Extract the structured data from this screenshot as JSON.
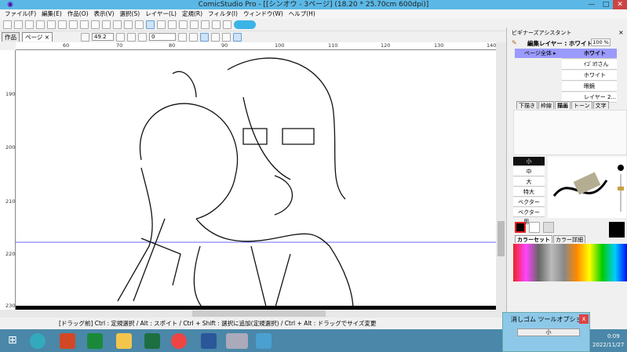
{
  "window": {
    "title": "ComicStudio Pro - [[シンオウ - 3ページ] (18.20 * 25.70cm 600dpi)]",
    "min": "—",
    "max": "□",
    "close": "✕"
  },
  "menu": [
    "ファイル(F)",
    "編集(E)",
    "作品(O)",
    "表示(V)",
    "選択(S)",
    "レイヤー(L)",
    "定規(R)",
    "フィルタ(I)",
    "ウィンドウ(W)",
    "ヘルプ(H)"
  ],
  "toolbar2": {
    "tabs": [
      "作品",
      "ページ ×"
    ],
    "zoom": "49.2",
    "angle": "0"
  },
  "rulers": {
    "h": [
      "60",
      "70",
      "80",
      "90",
      "100",
      "110",
      "120",
      "130",
      "140"
    ],
    "v": [
      "190",
      "200",
      "210",
      "220",
      "230"
    ]
  },
  "status": "[ドラッグ前] Ctrl : 定規選択 / Alt : スポイト / Ctrl + Shift : 選択に追加(定規選択) / Ctrl + Alt : ドラッグでサイズ変更",
  "panel": {
    "title": "ビギナーズアシスタント",
    "close": "×",
    "edit_layer_label": "編集レイヤー : ホワイト",
    "opacity": "100 %",
    "page_all": "ページ全体 ▸",
    "layers": [
      {
        "name": "ホワイト",
        "selected": true
      },
      {
        "name": "ｲｺﾞﾖｳさん"
      },
      {
        "name": "ホワイト"
      },
      {
        "name": "眼鏡"
      },
      {
        "name": "レイヤー 2..."
      }
    ],
    "tabs": [
      "下描き",
      "枠線",
      "描画",
      "トーン",
      "文字"
    ],
    "active_tab": "描画",
    "brush_sizes": [
      "小",
      "中",
      "大",
      "特大",
      "ベクター用...",
      "ベクター用..."
    ],
    "selected_brush": "小",
    "color_tabs": [
      "カラーセット",
      "カラー詳細"
    ]
  },
  "eraser_options": {
    "title": "消しゴム ツールオプション",
    "close": "x",
    "size": "小"
  },
  "taskbar": {
    "time": "0:09",
    "date": "2022/11/27",
    "apps": [
      "PowerPoint",
      "Store",
      "Explorer",
      "Excel",
      "Chrome",
      "Word",
      "ComicStudio",
      "Photos"
    ]
  },
  "colors": {
    "accent": "#5bb8e6",
    "selected_layer": "#9a9aff",
    "taskbar": "#4a87a8"
  }
}
